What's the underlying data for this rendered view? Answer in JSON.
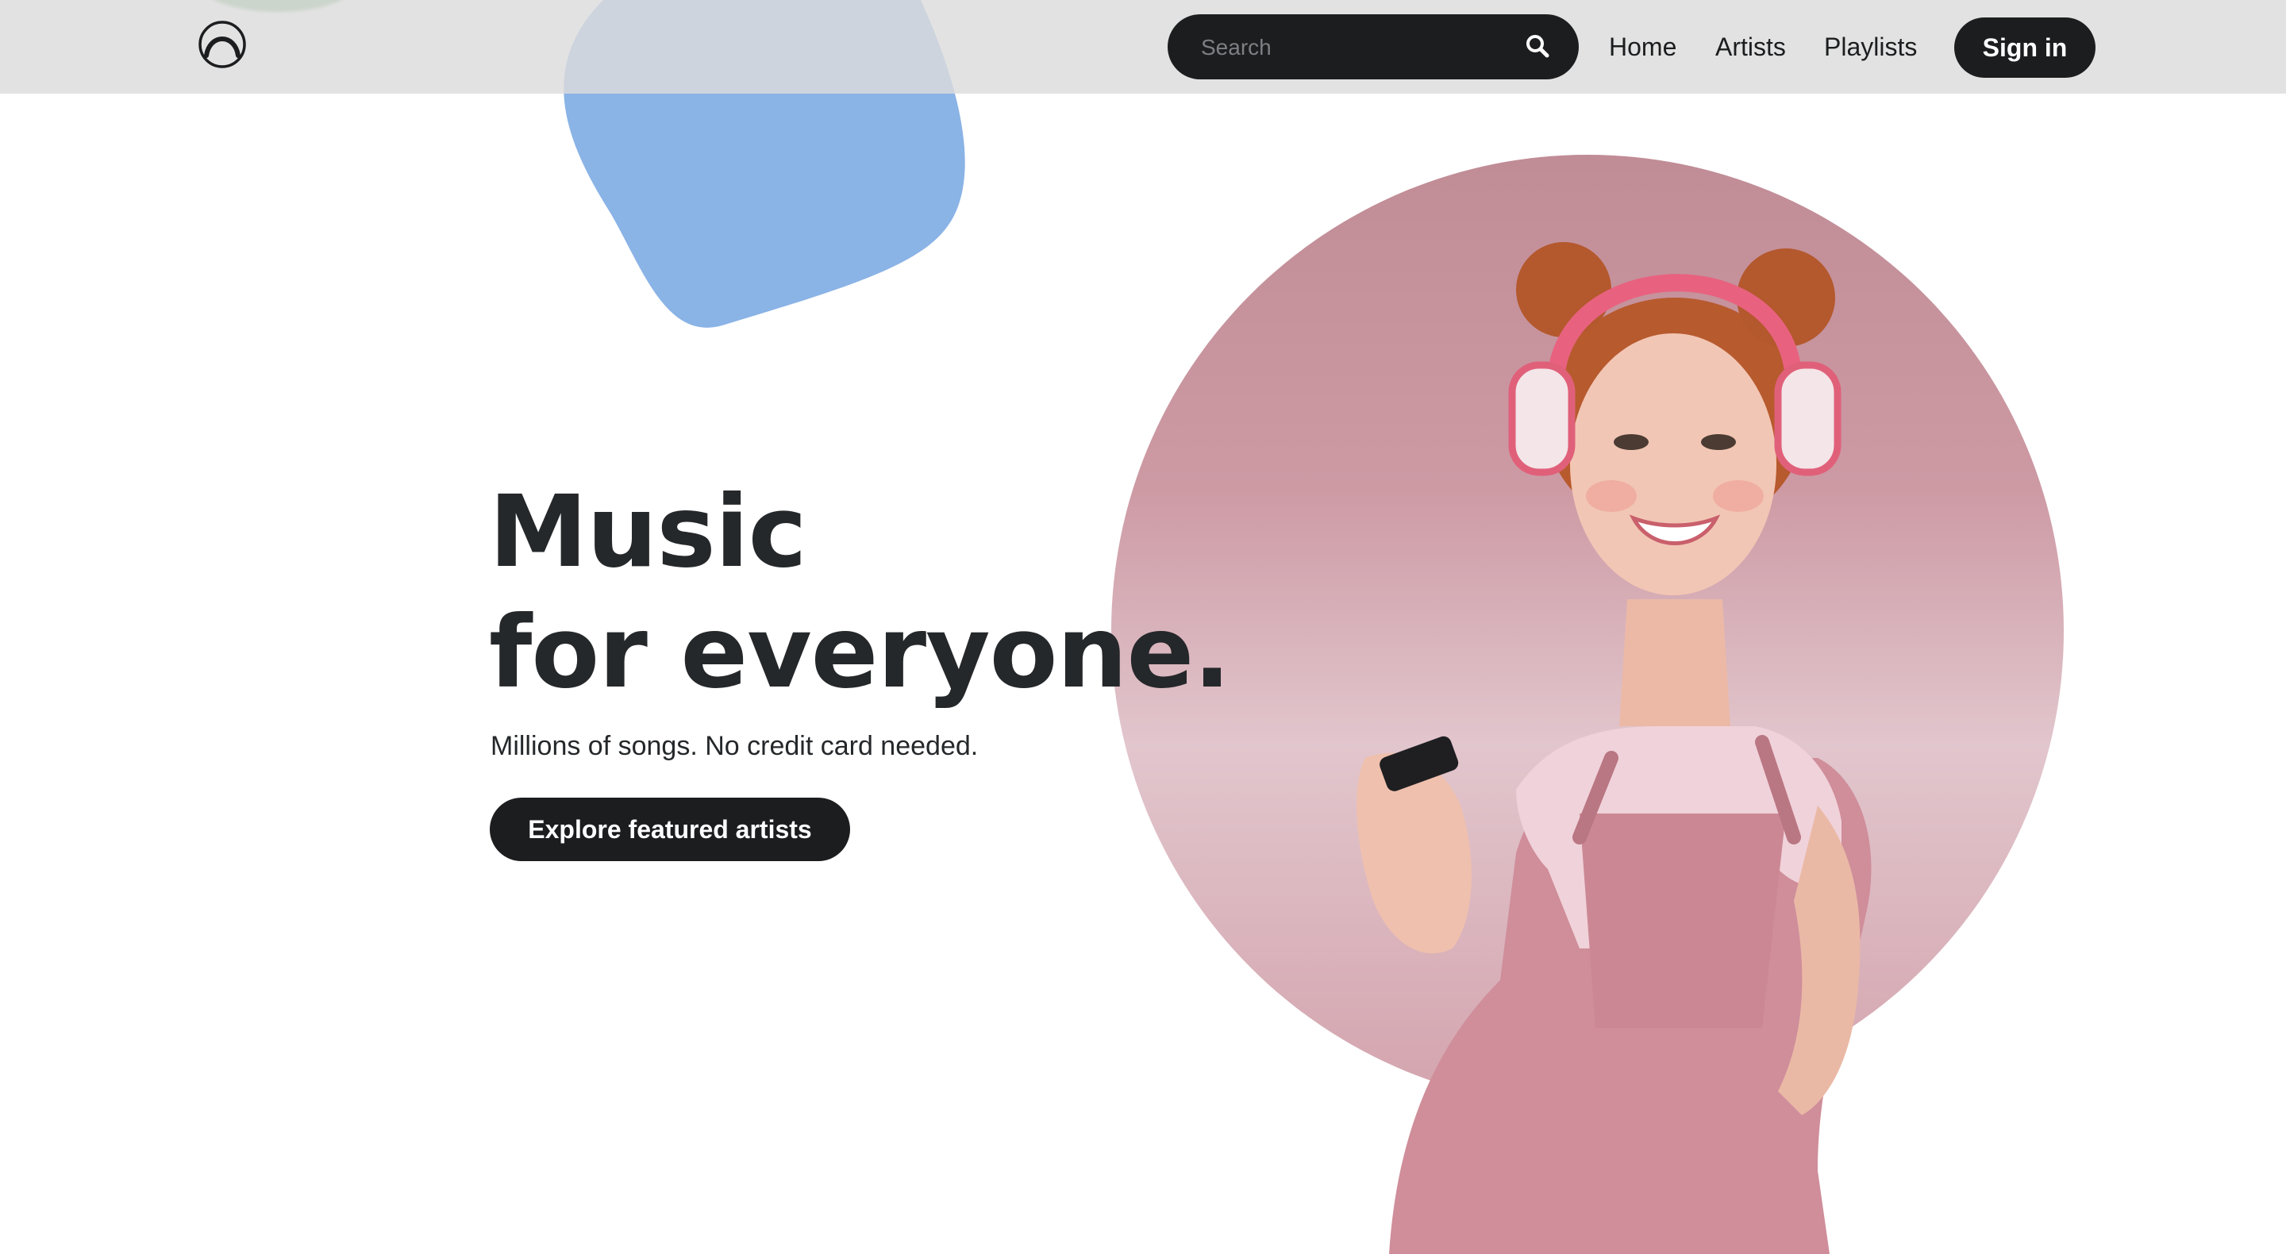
{
  "header": {
    "search": {
      "placeholder": "Search",
      "icon": "search-icon"
    },
    "nav": [
      {
        "label": "Home"
      },
      {
        "label": "Artists"
      },
      {
        "label": "Playlists"
      }
    ],
    "signin_label": "Sign in",
    "logo_icon": "logo-icon"
  },
  "hero": {
    "title_line1": "Music",
    "title_line2": "for everyone.",
    "subtitle": "Millions of songs. No credit card needed.",
    "cta_label": "Explore featured artists",
    "image": "woman-with-headphones"
  },
  "colors": {
    "dark": "#1c1d1f",
    "header_bg": "#e2e2e2",
    "blob_blue": "#8ab3e6",
    "blob_green": "#6aa86a",
    "circle_pink": "#c8909a"
  }
}
